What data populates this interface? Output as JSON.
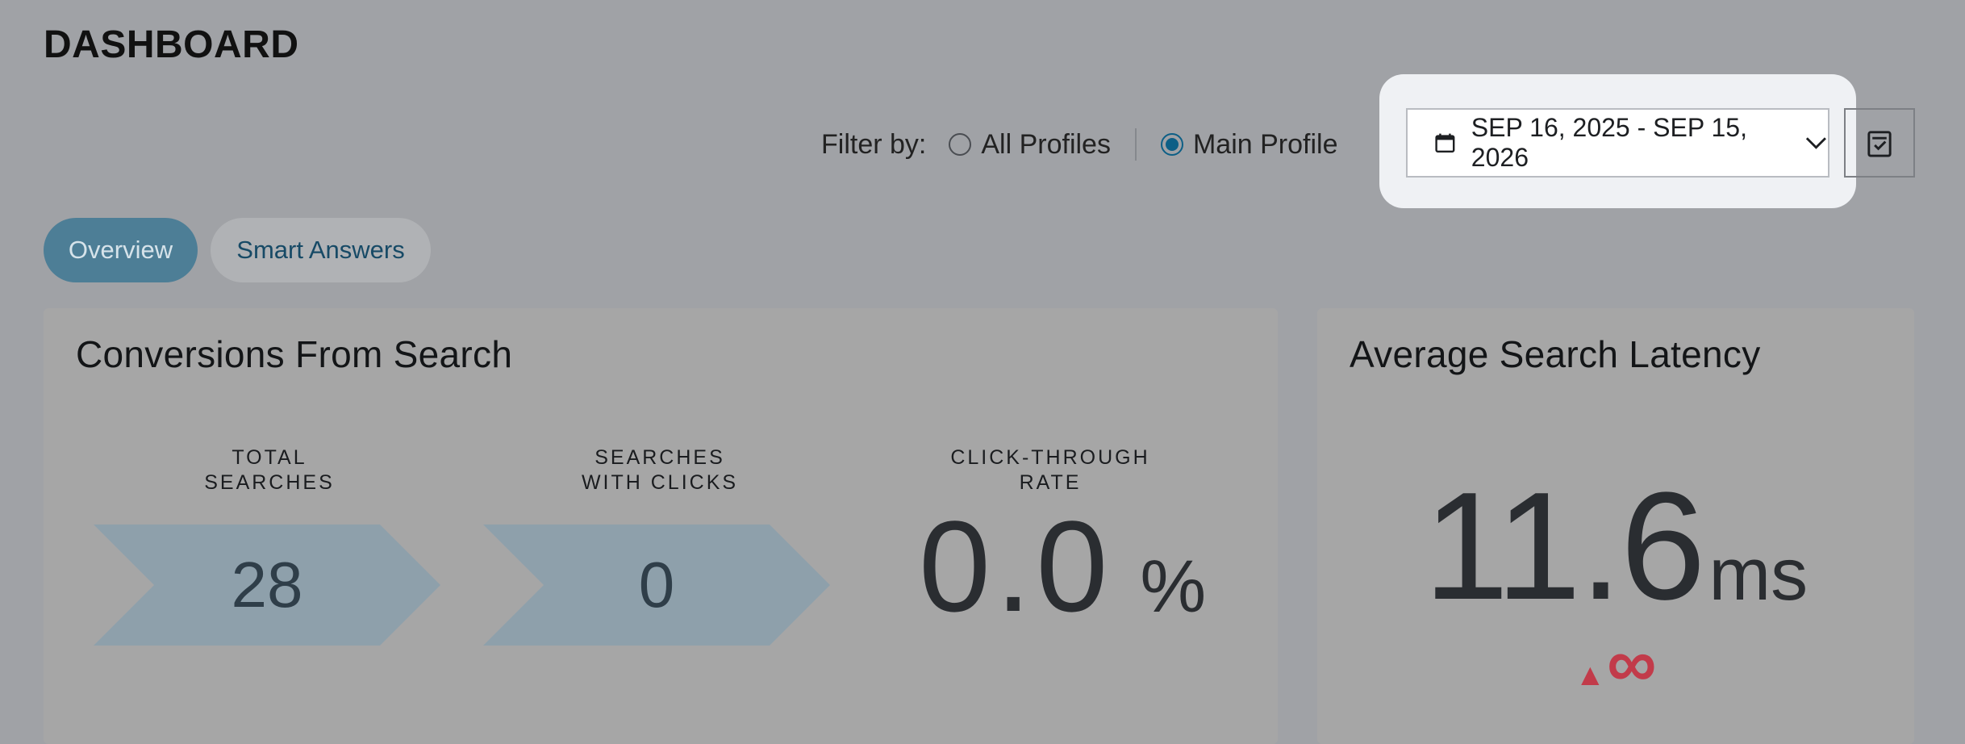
{
  "header": {
    "title": "DASHBOARD"
  },
  "filter": {
    "label": "Filter by:",
    "options": [
      {
        "label": "All Profiles",
        "selected": false
      },
      {
        "label": "Main Profile",
        "selected": true
      }
    ]
  },
  "date_range": {
    "label": "SEP 16, 2025 - SEP 15, 2026",
    "icon": "calendar-icon"
  },
  "export_button": {
    "icon": "clipboard-check-icon"
  },
  "tabs": [
    {
      "label": "Overview",
      "active": true
    },
    {
      "label": "Smart Answers",
      "active": false
    }
  ],
  "conversions_card": {
    "title": "Conversions From Search",
    "metrics": [
      {
        "label_line1": "TOTAL",
        "label_line2": "SEARCHES",
        "value": "28"
      },
      {
        "label_line1": "SEARCHES",
        "label_line2": "WITH CLICKS",
        "value": "0"
      },
      {
        "label_line1": "CLICK-THROUGH",
        "label_line2": "RATE",
        "value": "0.0",
        "unit": "%"
      }
    ]
  },
  "latency_card": {
    "title": "Average Search Latency",
    "value": "11.6",
    "unit": "ms",
    "change_arrow": "▲",
    "change_value": "∞"
  },
  "colors": {
    "accent": "#0d5f86",
    "tab_active": "#4d7e96",
    "arrow_fill": "#8ea0ab",
    "negative_change": "#c23b4a"
  }
}
